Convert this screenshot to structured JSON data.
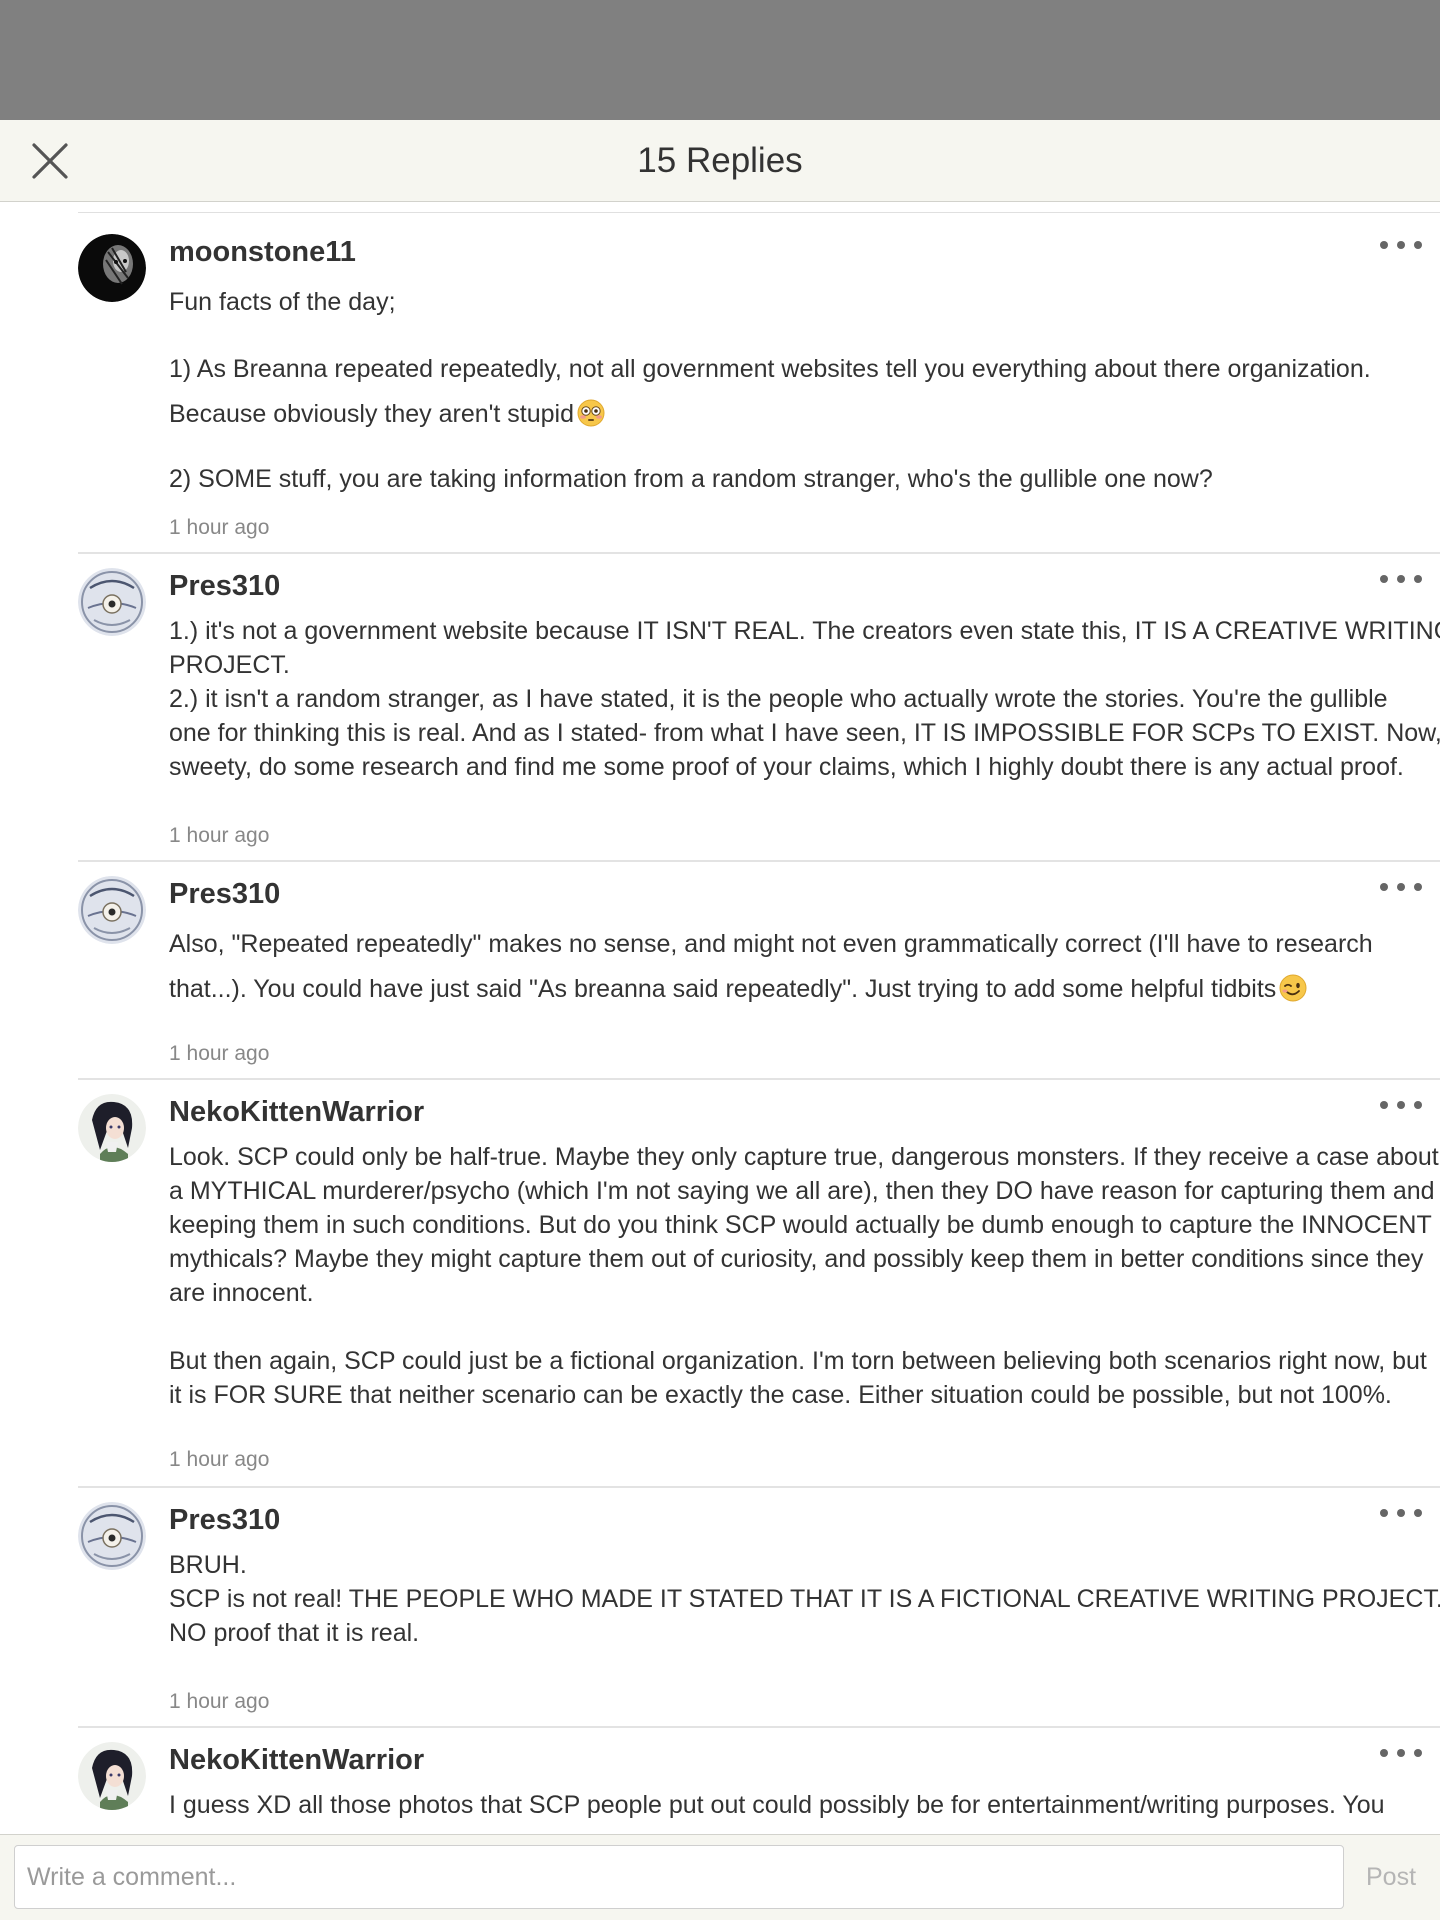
{
  "header": {
    "title": "15 Replies",
    "close_icon": "close-icon"
  },
  "comments": [
    {
      "username": "moonstone11",
      "avatar": "dark-tiger-avatar",
      "lines": [
        "Fun facts of the day;",
        "",
        "1) As Breanna repeated repeatedly, not all government websites tell you everything about there organization.",
        "Because obviously they aren't stupid",
        "",
        "2) SOME stuff, you are taking information from a random stranger, who's the gullible one now?"
      ],
      "emoji": "flushed-face-emoji",
      "time": "1 hour ago"
    },
    {
      "username": "Pres310",
      "avatar": "ouija-board-avatar",
      "lines": [
        "1.) it's not a government website because IT ISN'T REAL. The creators even state this, IT IS A CREATIVE WRITING",
        "PROJECT.",
        "2.) it isn't a random stranger, as I have stated, it is the people who actually wrote the stories. You're the gullible",
        "one for thinking this is real. And as I stated- from what I have seen, IT IS IMPOSSIBLE FOR SCPs TO EXIST. Now,",
        "sweety, do some research and find me some proof of your claims, which I highly doubt there is any actual proof."
      ],
      "time": "1 hour ago"
    },
    {
      "username": "Pres310",
      "avatar": "ouija-board-avatar",
      "lines": [
        "Also, \"Repeated repeatedly\" makes no sense, and might not even grammatically correct (I'll have to research",
        "that...). You could have just said \"As breanna said repeatedly\". Just trying to add some helpful tidbits"
      ],
      "emoji": "winking-face-emoji",
      "time": "1 hour ago"
    },
    {
      "username": "NekoKittenWarrior",
      "avatar": "anime-girl-avatar",
      "lines": [
        "Look. SCP could only be half-true. Maybe they only capture true, dangerous monsters. If they receive a case about",
        "a MYTHICAL murderer/psycho (which I'm not saying we all are), then they DO have reason for capturing them and",
        "keeping them in such conditions. But do you think SCP would actually be dumb enough to capture the INNOCENT",
        "mythicals? Maybe they might capture them out of curiosity, and possibly keep them in better conditions since they",
        "are innocent.",
        "",
        "But then again, SCP could just be a fictional organization. I'm torn between believing both scenarios right now, but",
        "it is FOR SURE that neither scenario can be exactly the case. Either situation could be possible, but not 100%."
      ],
      "time": "1 hour ago"
    },
    {
      "username": "Pres310",
      "avatar": "ouija-board-avatar",
      "lines": [
        "BRUH.",
        "SCP is not real! THE PEOPLE WHO MADE IT STATED THAT IT IS A FICTIONAL CREATIVE WRITING PROJECT. There is",
        "NO proof that it is real."
      ],
      "time": "1 hour ago"
    },
    {
      "username": "NekoKittenWarrior",
      "avatar": "anime-girl-avatar",
      "lines": [
        "I guess XD all those photos that SCP people put out could possibly be for entertainment/writing purposes. You"
      ],
      "time": ""
    }
  ],
  "footer": {
    "placeholder": "Write a comment...",
    "post_label": "Post"
  },
  "colors": {
    "overlay": "#808080",
    "header_bg": "#f6f6f0",
    "text": "#333333",
    "timestamp": "#888888",
    "post_disabled": "#b5b5b5"
  }
}
